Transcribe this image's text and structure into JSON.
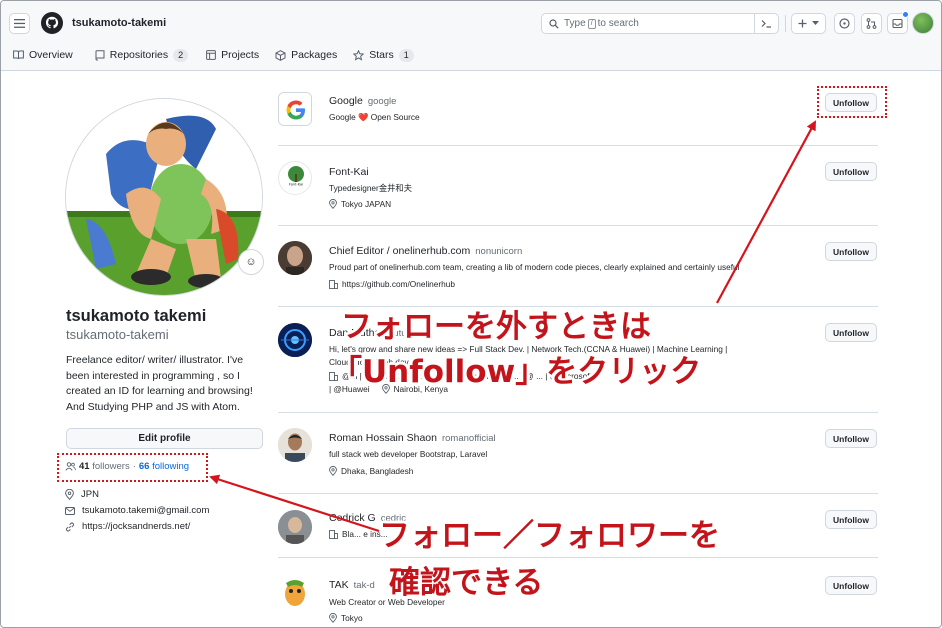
{
  "header": {
    "username": "tsukamoto-takemi",
    "search_placeholder_pre": "Type",
    "search_key": "/",
    "search_placeholder_post": "to search"
  },
  "tabs": [
    {
      "label": "Overview",
      "icon": "book-icon"
    },
    {
      "label": "Repositories",
      "count": "2",
      "icon": "repo-icon"
    },
    {
      "label": "Projects",
      "icon": "table-icon"
    },
    {
      "label": "Packages",
      "icon": "package-icon"
    },
    {
      "label": "Stars",
      "count": "1",
      "icon": "star-icon"
    }
  ],
  "profile": {
    "name": "tsukamoto takemi",
    "login": "tsukamoto-takemi",
    "bio": "Freelance editor/ writer/ illustrator. I've been interested in programming , so I created an ID for learning and browsing! And Studying PHP and JS with Atom.",
    "edit_label": "Edit profile",
    "followers_count": "41",
    "followers_label": "followers",
    "separator": "·",
    "following_count": "66",
    "following_label": "following",
    "location": "JPN",
    "email": "tsukamoto.takemi@gmail.com",
    "website": "https://jocksandnerds.net/"
  },
  "following": [
    {
      "name": "Google",
      "login": "google",
      "desc_pre": "Google",
      "desc_post": "Open Source",
      "location": "",
      "button": "Unfollow"
    },
    {
      "name": "Font-Kai",
      "login": "",
      "desc": "Typedesigner金井和夫",
      "location": "Tokyo JAPAN",
      "button": "Unfollow"
    },
    {
      "name": "Chief Editor / onelinerhub.com",
      "login": "nonunicorn",
      "desc": "Proud part of onelinerhub.com team, creating a lib of modern code pieces, clearly explained and certainly useful",
      "location": "https://github.com/Onelinerhub",
      "button": "Unfollow"
    },
    {
      "name": "Dan   Mutha",
      "login": "mutuutha",
      "desc": "Hi, let's grow and share new ideas => Full Stack Dev. | Network Tech.(CCNA & Huawei) | Machine Learning |",
      "desc2": "Cloud | IoT | Web dev",
      "loc_pre": "@m  | Nanyuki City | ...nologies | Nairobi City | ... | @ ... | @Microsoft",
      "loc_post": "| @Huawei",
      "location": "Nairobi, Kenya",
      "button": "Unfollow"
    },
    {
      "name": "Roman Hossain Shaon",
      "login": "romanofficial",
      "desc": "full stack web developer Bootstrap, Laravel",
      "location": "Dhaka, Bangladesh",
      "button": "Unfollow"
    },
    {
      "name": "Cedrick G",
      "login": "cedric",
      "desc": "Bla... e ins...",
      "location": "",
      "button": "Unfollow"
    },
    {
      "name": "TAK",
      "login": "tak-d",
      "desc": "Web Creator or Web Developer",
      "location": "Tokyo",
      "button": "Unfollow"
    }
  ],
  "annotations": {
    "unfollow_line1": "フォローを外すときは",
    "unfollow_line2": "「Unfollow」をクリック",
    "follow_line1": "フォロー／フォロワーを",
    "follow_line2": "確認できる",
    "color": "#d6141b"
  }
}
